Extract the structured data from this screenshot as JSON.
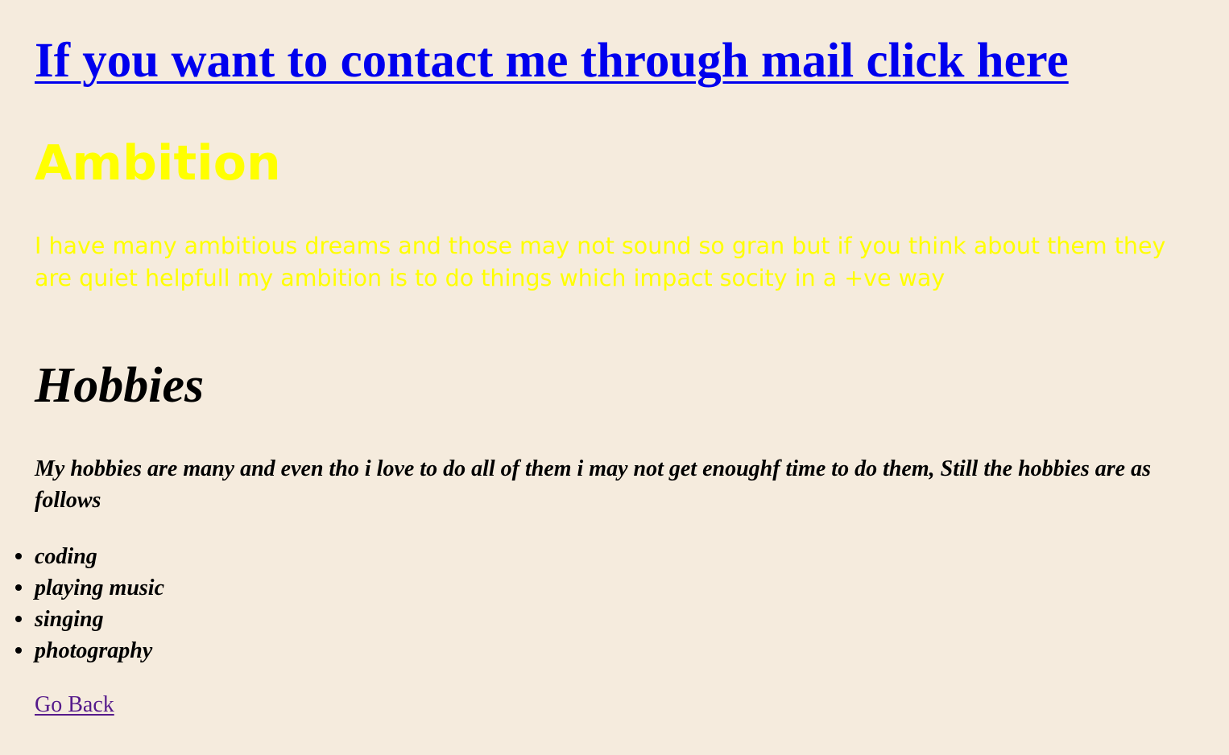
{
  "contact": {
    "link_text": "If you want to contact me through mail click here"
  },
  "ambition": {
    "title": "Ambition",
    "text": "I have many ambitious dreams and those may not sound so gran but if you think about them they are quiet helpfull my ambition is to do things which impact socity in a +ve way"
  },
  "hobbies": {
    "title": "Hobbies",
    "intro": "My hobbies are many and even tho i love to do all of them i may not get enoughf time to do them, Still the hobbies are as follows",
    "items": [
      "coding",
      "playing music",
      "singing",
      "photography"
    ]
  },
  "navigation": {
    "go_back_label": "Go Back"
  },
  "colors": {
    "background": "#f5ebdd",
    "link": "#0000ee",
    "visited_link": "#551a8b",
    "ambition_text": "#ffff00",
    "body_text": "#000000"
  }
}
